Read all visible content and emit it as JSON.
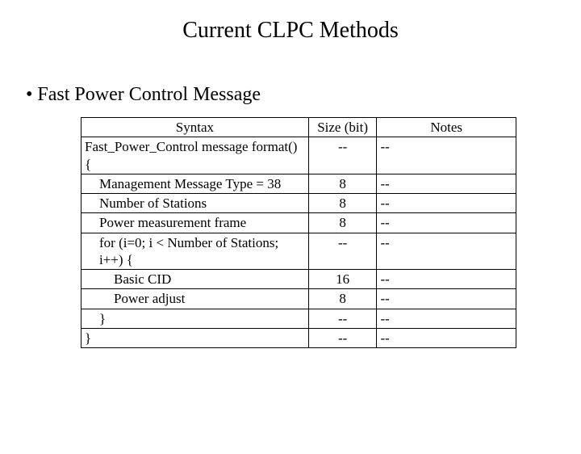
{
  "title": "Current CLPC Methods",
  "bullet": "•  Fast Power Control Message",
  "table": {
    "headers": {
      "syntax": "Syntax",
      "size": "Size (bit)",
      "notes": "Notes"
    },
    "rows": [
      {
        "syntax": "Fast_Power_Control message format() {",
        "size": "--",
        "notes": "--",
        "indent": 0
      },
      {
        "syntax": "Management Message Type = 38",
        "size": "8",
        "notes": "--",
        "indent": 1
      },
      {
        "syntax": "Number of Stations",
        "size": "8",
        "notes": "--",
        "indent": 1
      },
      {
        "syntax": "Power measurement frame",
        "size": "8",
        "notes": "--",
        "indent": 1
      },
      {
        "syntax": "for (i=0; i < Number of Stations; i++) {",
        "size": "--",
        "notes": "--",
        "indent": 1
      },
      {
        "syntax": "Basic CID",
        "size": "16",
        "notes": "--",
        "indent": 2
      },
      {
        "syntax": "Power adjust",
        "size": "8",
        "notes": "--",
        "indent": 2
      },
      {
        "syntax": "}",
        "size": "--",
        "notes": "--",
        "indent": 1
      },
      {
        "syntax": "}",
        "size": "--",
        "notes": "--",
        "indent": 0
      }
    ]
  }
}
